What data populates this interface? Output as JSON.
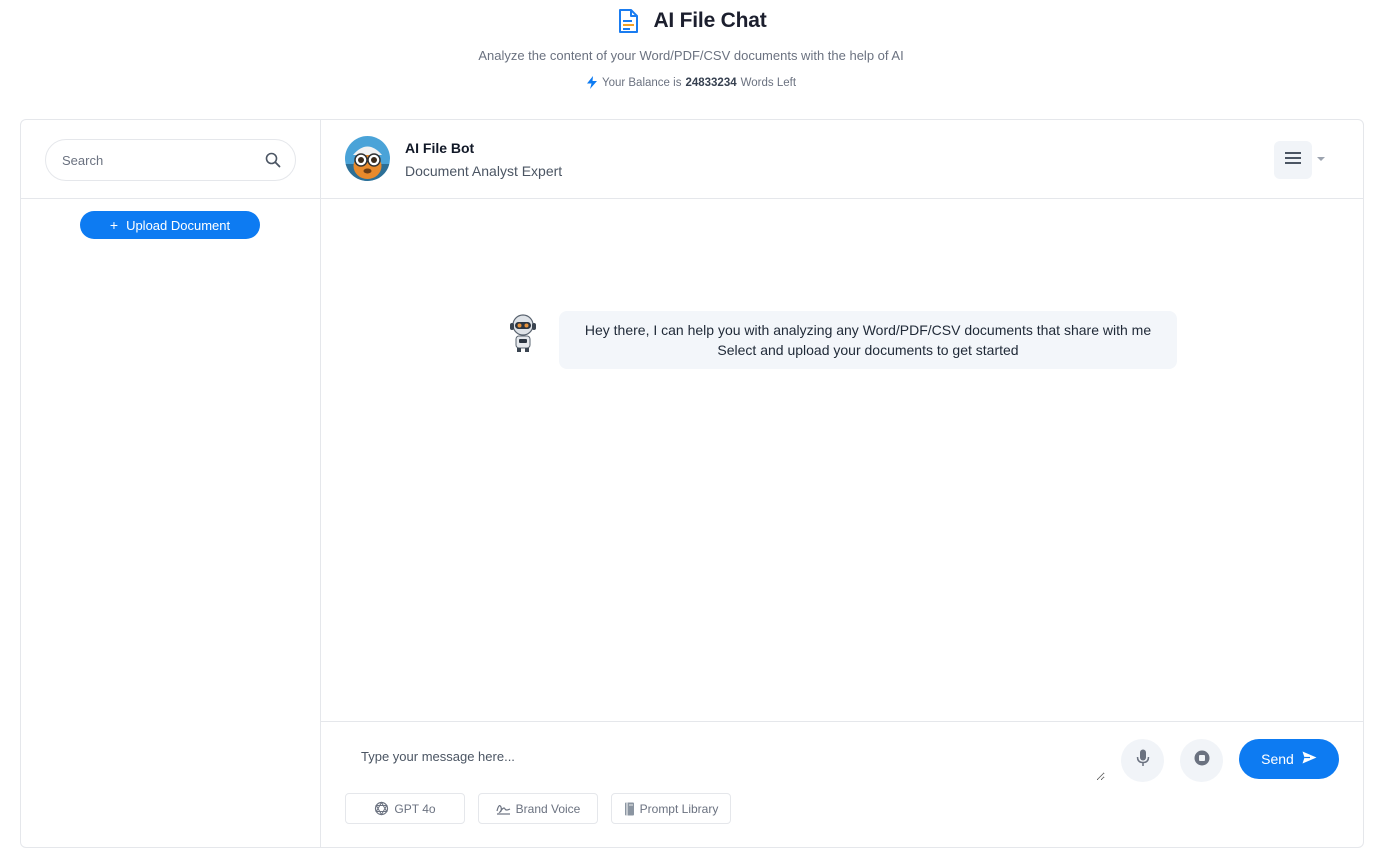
{
  "header": {
    "title": "AI File Chat",
    "subtitle": "Analyze the content of your Word/PDF/CSV documents with the help of AI",
    "balance_prefix": "Your Balance is",
    "balance_value": "24833234",
    "balance_suffix": "Words Left",
    "icon": "file-document-icon"
  },
  "sidebar": {
    "search_placeholder": "Search",
    "upload_label": "Upload Document"
  },
  "chat": {
    "bot_name": "AI File Bot",
    "bot_role": "Document Analyst Expert",
    "messages": [
      {
        "sender": "bot",
        "line1": "Hey there, I can help you with analyzing any Word/PDF/CSV documents that share with me",
        "line2": "Select and upload your documents to get started"
      }
    ]
  },
  "composer": {
    "placeholder": "Type your message here...",
    "send_label": "Send",
    "chips": {
      "model": "GPT 4o",
      "brand_voice": "Brand Voice",
      "prompt_library": "Prompt Library"
    }
  },
  "colors": {
    "accent": "#0d7bf2",
    "bubble": "#f3f6fa",
    "border": "#e5e7eb"
  }
}
